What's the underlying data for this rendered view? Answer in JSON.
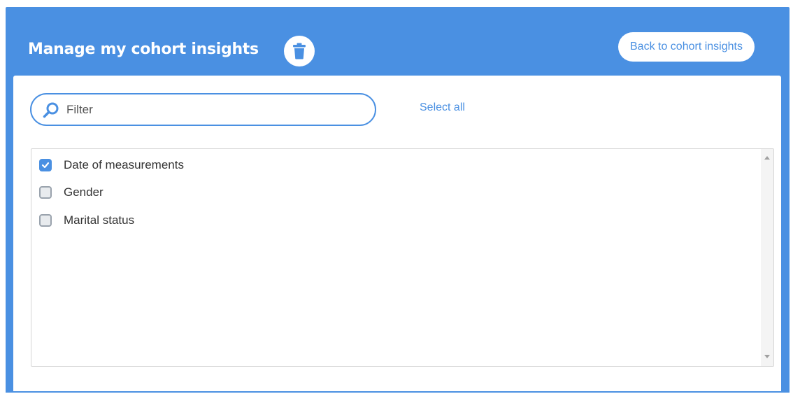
{
  "header": {
    "title": "Manage my cohort insights",
    "back_button_label": "Back to cohort insights"
  },
  "filter": {
    "placeholder": "Filter",
    "value": ""
  },
  "select_all_label": "Select all",
  "list": {
    "items": [
      {
        "label": "Date of measurements",
        "checked": true
      },
      {
        "label": "Gender",
        "checked": false
      },
      {
        "label": "Marital status",
        "checked": false
      }
    ]
  },
  "icons": {
    "trash": "trash-icon",
    "search": "search-icon",
    "check": "check-icon"
  },
  "colors": {
    "accent": "#4a90e2",
    "panel": "#ffffff",
    "text": "#333333",
    "border": "#d6d6d6"
  }
}
